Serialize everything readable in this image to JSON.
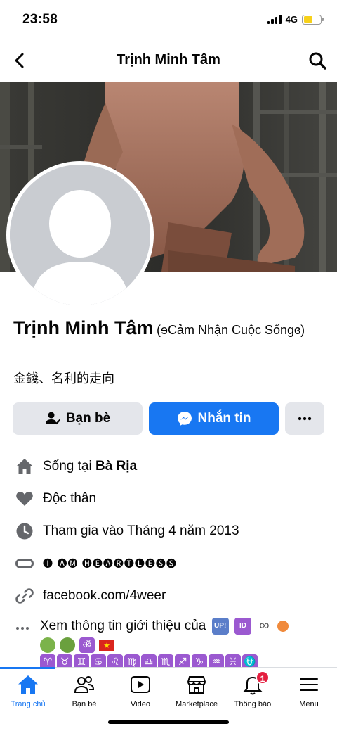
{
  "status": {
    "time": "23:58",
    "network": "4G",
    "battery_level": 0.55,
    "battery_color": "#f7d11a"
  },
  "nav": {
    "title": "Trịnh Minh Tâm",
    "back_icon": "chevron-left-icon",
    "search_icon": "search-icon"
  },
  "profile": {
    "name": "Trịnh Minh Tâm",
    "alternate_name": "(ɘCảm Nhận Cuộc Sốngɞ)",
    "bio": "金錢、名利的走向"
  },
  "actions": {
    "friends_label": "Bạn bè",
    "message_label": "Nhắn tin",
    "more_label": "···"
  },
  "info": {
    "lives_prefix": "Sống tại ",
    "lives_place": "Bà Rịa",
    "relationship": "Độc thân",
    "joined": "Tham gia vào Tháng 4 năm 2013",
    "tagline": "🅘 🅐🅜 🅗🅔🅐🅡🅣🅛🅔🅢🅢",
    "website": "facebook.com/4weer"
  },
  "intro": {
    "label": "Xem thông tin giới thiệu của",
    "badges": [
      "UP!",
      "ID"
    ],
    "zodiac": [
      "♈",
      "♉",
      "♊",
      "♋",
      "♌",
      "♍",
      "♎",
      "♏",
      "♐",
      "♑",
      "♒",
      "♓",
      "⛎"
    ]
  },
  "tabs": [
    {
      "label": "Trang chủ",
      "icon": "home-icon",
      "active": true
    },
    {
      "label": "Bạn bè",
      "icon": "friends-icon",
      "active": false
    },
    {
      "label": "Video",
      "icon": "video-icon",
      "active": false
    },
    {
      "label": "Marketplace",
      "icon": "marketplace-icon",
      "active": false
    },
    {
      "label": "Thông báo",
      "icon": "bell-icon",
      "active": false,
      "badge": "1"
    },
    {
      "label": "Menu",
      "icon": "menu-icon",
      "active": false
    }
  ],
  "colors": {
    "accent": "#1877f2",
    "badge": "#e41e3f",
    "button_grey": "#e4e6eb"
  }
}
